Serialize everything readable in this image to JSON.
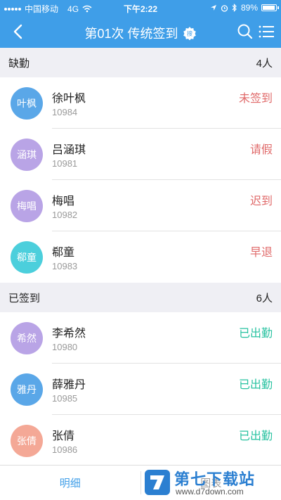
{
  "status_bar": {
    "carrier": "中国移动",
    "network": "4G",
    "time": "下午2:22",
    "battery": "89%"
  },
  "nav": {
    "title": "第01次 传统签到",
    "badge_text": "搜"
  },
  "colors": {
    "primary": "#3f9ee8",
    "absent_text": "#e06a6a",
    "present_text": "#27c2a0"
  },
  "sections": [
    {
      "title": "缺勤",
      "count": "4人",
      "rows": [
        {
          "avatar_text": "叶枫",
          "name": "徐叶枫",
          "id": "10984",
          "status": "未签到",
          "avatar_color": "#5aa7e8"
        },
        {
          "avatar_text": "涵琪",
          "name": "吕涵琪",
          "id": "10981",
          "status": "请假",
          "avatar_color": "#b9a4e6"
        },
        {
          "avatar_text": "梅唱",
          "name": "梅唱",
          "id": "10982",
          "status": "迟到",
          "avatar_color": "#b9a4e6"
        },
        {
          "avatar_text": "郗童",
          "name": "郗童",
          "id": "10983",
          "status": "早退",
          "avatar_color": "#4ccfdc"
        }
      ]
    },
    {
      "title": "已签到",
      "count": "6人",
      "rows": [
        {
          "avatar_text": "希然",
          "name": "李希然",
          "id": "10980",
          "status": "已出勤",
          "avatar_color": "#b9a4e6"
        },
        {
          "avatar_text": "雅丹",
          "name": "薛雅丹",
          "id": "10985",
          "status": "已出勤",
          "avatar_color": "#5aa7e8"
        },
        {
          "avatar_text": "张倩",
          "name": "张倩",
          "id": "10986",
          "status": "已出勤",
          "avatar_color": "#f4a896"
        }
      ]
    }
  ],
  "tabs": {
    "detail": "明细",
    "chart": "图表"
  },
  "watermark": {
    "title": "第七下载站",
    "url": "www.d7down.com"
  }
}
